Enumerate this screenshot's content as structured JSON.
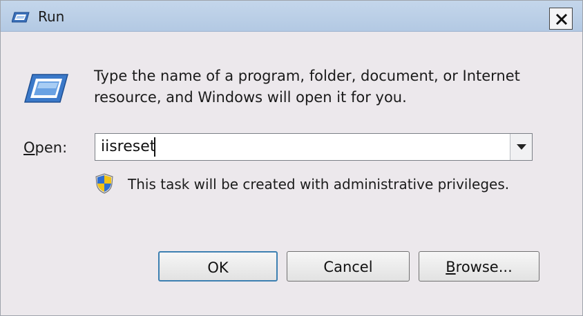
{
  "window": {
    "title": "Run",
    "close_icon": "close-icon"
  },
  "prompt": {
    "icon": "run-icon",
    "line1": "Type the name of a program, folder, document, or Internet",
    "line2": "resource, and Windows will open it for you."
  },
  "open": {
    "label_first": "O",
    "label_rest": "pen:",
    "value": "iisreset"
  },
  "admin_note": {
    "icon": "uac-shield-icon",
    "text": "This task will be created with administrative privileges."
  },
  "buttons": {
    "ok": "OK",
    "cancel": "Cancel",
    "browse_first": "B",
    "browse_rest": "rowse..."
  },
  "colors": {
    "titlebar": "#b3c9e3",
    "dialog_bg": "#ece8ec",
    "default_button_border": "#3c7fb1"
  }
}
